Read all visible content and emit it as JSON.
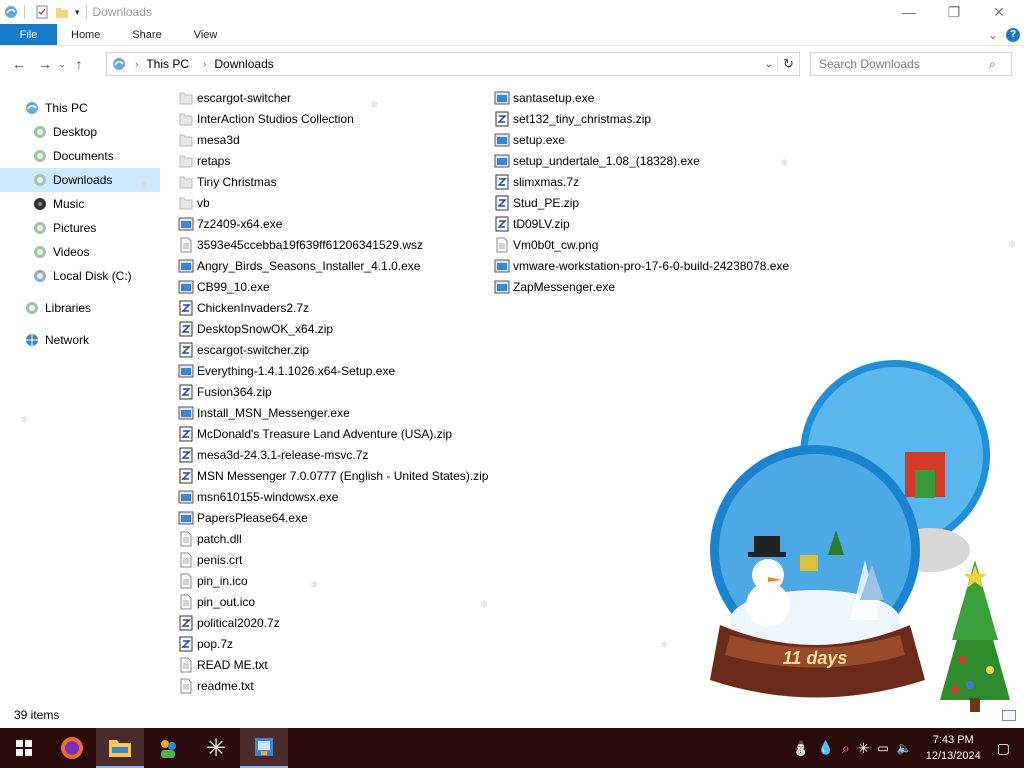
{
  "window": {
    "title": "Downloads",
    "minimize": "—",
    "maximize": "❐",
    "close": "✕"
  },
  "ribbon": {
    "tabs": [
      "File",
      "Home",
      "Share",
      "View"
    ],
    "expand_icon": "⌄",
    "help": "?"
  },
  "address": {
    "crumbs": [
      "This PC",
      "Downloads"
    ],
    "search_placeholder": "Search Downloads"
  },
  "navpane": {
    "items": [
      {
        "label": "This PC",
        "icon": "pc-icon"
      },
      {
        "label": "Desktop",
        "icon": "desktop-icon"
      },
      {
        "label": "Documents",
        "icon": "documents-icon"
      },
      {
        "label": "Downloads",
        "icon": "downloads-icon"
      },
      {
        "label": "Music",
        "icon": "music-icon"
      },
      {
        "label": "Pictures",
        "icon": "pictures-icon"
      },
      {
        "label": "Videos",
        "icon": "videos-icon"
      },
      {
        "label": "Local Disk (C:)",
        "icon": "disk-icon"
      },
      {
        "label": "Libraries",
        "icon": "libraries-icon"
      },
      {
        "label": "Network",
        "icon": "network-icon"
      }
    ]
  },
  "files": {
    "col1": [
      {
        "name": "escargot-switcher",
        "type": "folder"
      },
      {
        "name": "InterAction Studios Collection",
        "type": "folder"
      },
      {
        "name": "mesa3d",
        "type": "folder"
      },
      {
        "name": "retaps",
        "type": "folder"
      },
      {
        "name": "Tiny Christmas",
        "type": "folder"
      },
      {
        "name": "vb",
        "type": "folder"
      },
      {
        "name": "7z2409-x64.exe",
        "type": "exe"
      },
      {
        "name": "3593e45ccebba19f639ff61206341529.wsz",
        "type": "doc"
      },
      {
        "name": "Angry_Birds_Seasons_Installer_4.1.0.exe",
        "type": "exe"
      },
      {
        "name": "CB99_10.exe",
        "type": "exe"
      },
      {
        "name": "ChickenInvaders2.7z",
        "type": "archive"
      },
      {
        "name": "DesktopSnowOK_x64.zip",
        "type": "archive"
      },
      {
        "name": "escargot-switcher.zip",
        "type": "archive"
      },
      {
        "name": "Everything-1.4.1.1026.x64-Setup.exe",
        "type": "exe"
      },
      {
        "name": "Fusion364.zip",
        "type": "archive"
      },
      {
        "name": "Install_MSN_Messenger.exe",
        "type": "exe"
      },
      {
        "name": "McDonald's Treasure Land Adventure (USA).zip",
        "type": "archive"
      },
      {
        "name": "mesa3d-24.3.1-release-msvc.7z",
        "type": "archive"
      },
      {
        "name": "MSN Messenger 7.0.0777 (English - United States).zip",
        "type": "archive"
      },
      {
        "name": "msn610155-windowsx.exe",
        "type": "exe"
      },
      {
        "name": "PapersPlease64.exe",
        "type": "exe"
      },
      {
        "name": "patch.dll",
        "type": "doc"
      },
      {
        "name": "penis.crt",
        "type": "doc"
      },
      {
        "name": "pin_in.ico",
        "type": "doc"
      },
      {
        "name": "pin_out.ico",
        "type": "doc"
      },
      {
        "name": "political2020.7z",
        "type": "archive"
      },
      {
        "name": "pop.7z",
        "type": "archive"
      },
      {
        "name": "READ ME.txt",
        "type": "doc"
      },
      {
        "name": "readme.txt",
        "type": "doc"
      }
    ],
    "col2": [
      {
        "name": "santasetup.exe",
        "type": "exe"
      },
      {
        "name": "set132_tiny_christmas.zip",
        "type": "archive"
      },
      {
        "name": "setup.exe",
        "type": "exe"
      },
      {
        "name": "setup_undertale_1.08_(18328).exe",
        "type": "exe"
      },
      {
        "name": "slimxmas.7z",
        "type": "archive"
      },
      {
        "name": "Stud_PE.zip",
        "type": "archive"
      },
      {
        "name": "tD09LV.zip",
        "type": "archive"
      },
      {
        "name": "Vm0b0t_cw.png",
        "type": "doc"
      },
      {
        "name": "vmware-workstation-pro-17-6-0-build-24238078.exe",
        "type": "exe"
      },
      {
        "name": "ZapMessenger.exe",
        "type": "exe"
      }
    ]
  },
  "status": {
    "items": "39 items"
  },
  "overlay": {
    "countdown": "11 days"
  },
  "taskbar": {
    "time": "7:43 PM",
    "date": "12/13/2024",
    "apps": [
      "start-icon",
      "firefox-icon",
      "file-explorer-icon",
      "people-icon",
      "snowflake-icon",
      "app-icon"
    ]
  },
  "colors": {
    "accent": "#1979ca",
    "selection": "#cce8ff",
    "taskbar": "#2a0a0a"
  }
}
